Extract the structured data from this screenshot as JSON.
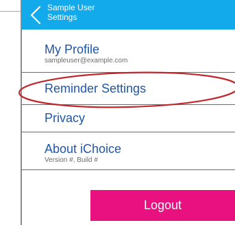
{
  "header": {
    "title_line1": "Sample User",
    "title_line2": "Settings",
    "back_icon": "chevron-left-icon",
    "color": "#12aaea"
  },
  "menu": {
    "profile": {
      "title": "My Profile",
      "subtitle": "sampleuser@example.com"
    },
    "reminder": {
      "title": "Reminder Settings"
    },
    "privacy": {
      "title": "Privacy"
    },
    "about": {
      "title": "About iChoice",
      "subtitle": "Version #, Build #"
    }
  },
  "logout": {
    "label": "Logout",
    "color": "#e8117f"
  },
  "annotation": {
    "color": "#c0262b",
    "highlight": "reminder-settings"
  }
}
